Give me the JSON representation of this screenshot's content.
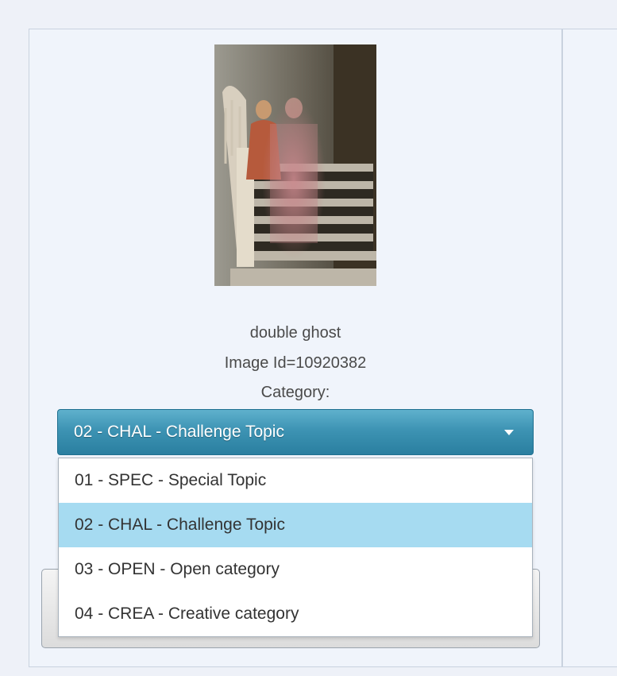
{
  "image": {
    "title": "double ghost",
    "id_text": "Image Id=10920382",
    "category_label": "Category:"
  },
  "category_select": {
    "selected": "02 - CHAL - Challenge Topic",
    "options": [
      "01 - SPEC - Special Topic",
      "02 - CHAL - Challenge Topic",
      "03 - OPEN - Open category",
      "04 - CREA - Creative category"
    ],
    "selected_index": 1
  },
  "colors": {
    "select_accent": "#3d93b3",
    "option_highlight": "#a6dbf1"
  },
  "icons": {
    "select_arrow": "caret-down-icon"
  }
}
